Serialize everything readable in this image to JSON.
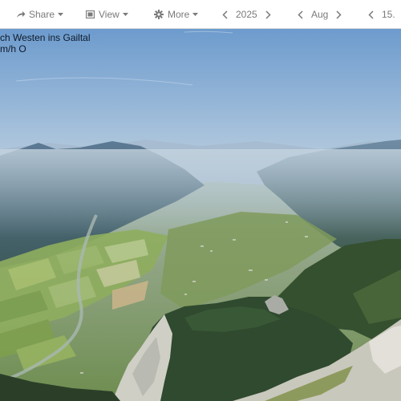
{
  "toolbar": {
    "share": {
      "label": "Share",
      "icon": "share-icon"
    },
    "view": {
      "label": "View",
      "icon": "image-icon"
    },
    "more": {
      "label": "More",
      "icon": "gear-icon"
    },
    "year": {
      "value": "2025"
    },
    "month": {
      "value": "Aug"
    },
    "day": {
      "value": "15."
    }
  },
  "caption": {
    "line1": "ch Westen ins Gailtal",
    "line2": "m/h O"
  },
  "colors": {
    "toolbar_text": "#7a7a7a",
    "sky_top": "#6f9ccd",
    "sky_haze": "#b9cedf",
    "forest": "#2e4a2e",
    "valley": "#7e9a5a",
    "rock": "#cfcfc8"
  }
}
